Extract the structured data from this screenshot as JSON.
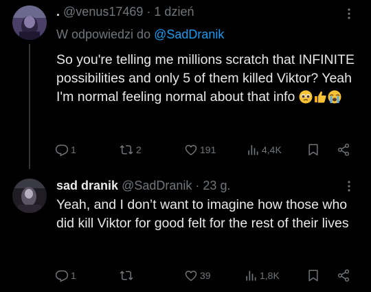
{
  "tweets": [
    {
      "display_name": ".",
      "handle": "@venus17469",
      "separator": "·",
      "time": "1 dzień",
      "reply_prefix": "W odpowiedzi do",
      "reply_mention": "@SadDranik",
      "text": "So you're telling me millions scratch that INFINITE possibilities and only 5 of them killed Viktor? Yeah I'm normal feeling normal about that info",
      "emojis": [
        "pleading-face",
        "thumbs-up",
        "loudly-crying-face"
      ],
      "replies": "1",
      "reposts": "2",
      "likes": "191",
      "views": "4,4K"
    },
    {
      "display_name": "sad dranik",
      "handle": "@SadDranik",
      "separator": "·",
      "time": "23 g.",
      "text": "Yeah, and I don’t want to imagine how those who did kill Viktor for good felt for the rest of their lives",
      "replies": "1",
      "reposts": "",
      "likes": "39",
      "views": "1,8K"
    }
  ],
  "colors": {
    "background": "#000000",
    "text": "#e7e9ea",
    "secondary": "#71767b",
    "mention": "#1d9bf0",
    "thread_line": "#333639"
  },
  "icons": [
    "more-icon",
    "reply-icon",
    "repost-icon",
    "like-icon",
    "views-icon",
    "bookmark-icon",
    "share-icon"
  ]
}
